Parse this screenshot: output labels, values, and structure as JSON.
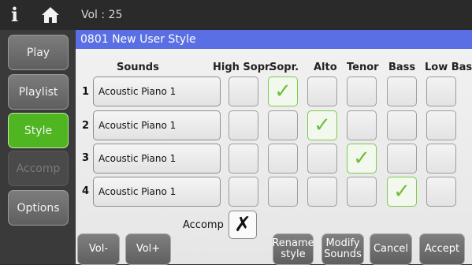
{
  "topbar": {
    "info_glyph": "i",
    "home_icon": "home-icon",
    "volume": "Vol : 25"
  },
  "sidebar": {
    "items": [
      {
        "label": "Play",
        "state": "normal"
      },
      {
        "label": "Playlist",
        "state": "normal"
      },
      {
        "label": "Style",
        "state": "active"
      },
      {
        "label": "Accomp",
        "state": "disabled"
      },
      {
        "label": "Options",
        "state": "normal"
      }
    ]
  },
  "title": "0801 New User Style",
  "headers": {
    "sounds": "Sounds",
    "high_sopr": "High Sopr.",
    "sopr": "Sopr.",
    "alto": "Alto",
    "tenor": "Tenor",
    "bass": "Bass",
    "low_bass": "Low Bass"
  },
  "rows": [
    {
      "num": "1",
      "sound": "Acoustic Piano 1",
      "checked": [
        "sopr"
      ]
    },
    {
      "num": "2",
      "sound": "Acoustic Piano 1",
      "checked": [
        "alto"
      ]
    },
    {
      "num": "3",
      "sound": "Acoustic Piano 1",
      "checked": [
        "tenor"
      ]
    },
    {
      "num": "4",
      "sound": "Acoustic Piano 1",
      "checked": [
        "bass"
      ]
    }
  ],
  "check_glyph": "✓",
  "accomp": {
    "label": "Accomp",
    "value_glyph": "✗"
  },
  "buttons": {
    "vol_minus": "Vol-",
    "vol_plus": "Vol+",
    "rename_style_line1": "Rename",
    "rename_style_line2": "style",
    "modify_sounds_line1": "Modify",
    "modify_sounds_line2": "Sounds",
    "cancel": "Cancel",
    "accept": "Accept"
  },
  "colors": {
    "accent_green": "#4fb521",
    "title_blue": "#5a6fe4",
    "check_green": "#6fbf3c"
  }
}
